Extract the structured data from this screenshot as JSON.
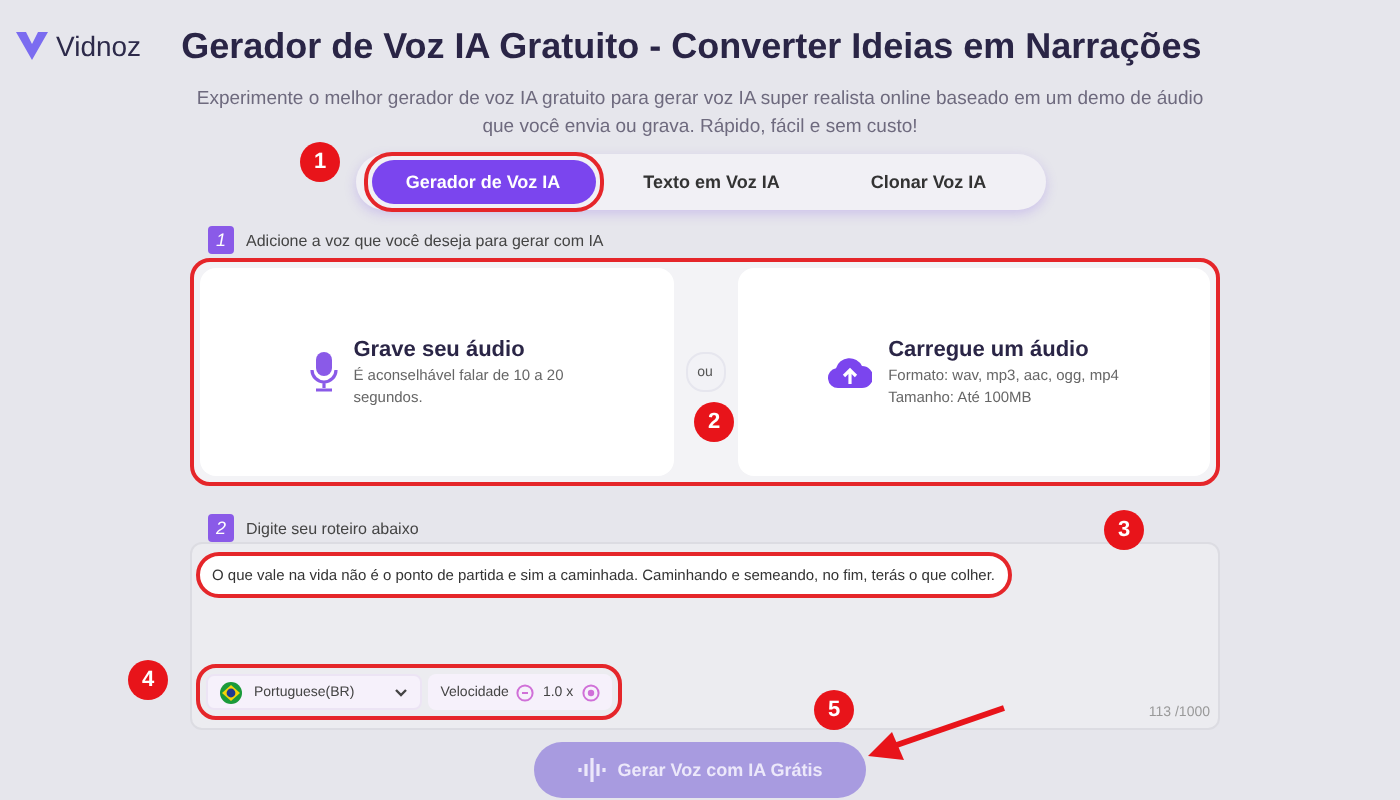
{
  "brand": {
    "name": "Vidnoz"
  },
  "title": "Gerador de Voz IA Gratuito - Converter Ideias em Narrações",
  "subtitle": [
    "Experimente o melhor gerador de voz IA gratuito para gerar voz IA super realista online baseado em um demo de áudio",
    "que você envia ou grava. Rápido, fácil e sem custo!"
  ],
  "tabs": [
    {
      "label": "Gerador de Voz IA",
      "selected": true
    },
    {
      "label": "Texto em Voz IA",
      "selected": false
    },
    {
      "label": "Clonar Voz IA",
      "selected": false
    }
  ],
  "step1": {
    "number": "1",
    "label": "Adicione a voz que você deseja para gerar com IA",
    "separator": "ou",
    "options": [
      {
        "kind": "record",
        "title": "Grave seu áudio",
        "lines": [
          "É aconselhável falar de 10 a 20",
          "segundos."
        ]
      },
      {
        "kind": "upload",
        "title": "Carregue um áudio",
        "lines": [
          "Formato: wav, mp3, aac, ogg, mp4",
          "Tamanho: Até 100MB"
        ]
      }
    ]
  },
  "step2": {
    "number": "2",
    "label": "Digite seu roteiro abaixo",
    "script": "O que vale na vida não é o ponto de partida e sim a caminhada. Caminhando e semeando, no fim, terás o que colher.",
    "language": "Portuguese(BR)",
    "speed_label": "Velocidade",
    "speed": "1.0 x",
    "counter": "113 /1000"
  },
  "generate_button": "Gerar Voz com IA Grátis",
  "callouts": [
    "1",
    "2",
    "3",
    "4",
    "5"
  ]
}
